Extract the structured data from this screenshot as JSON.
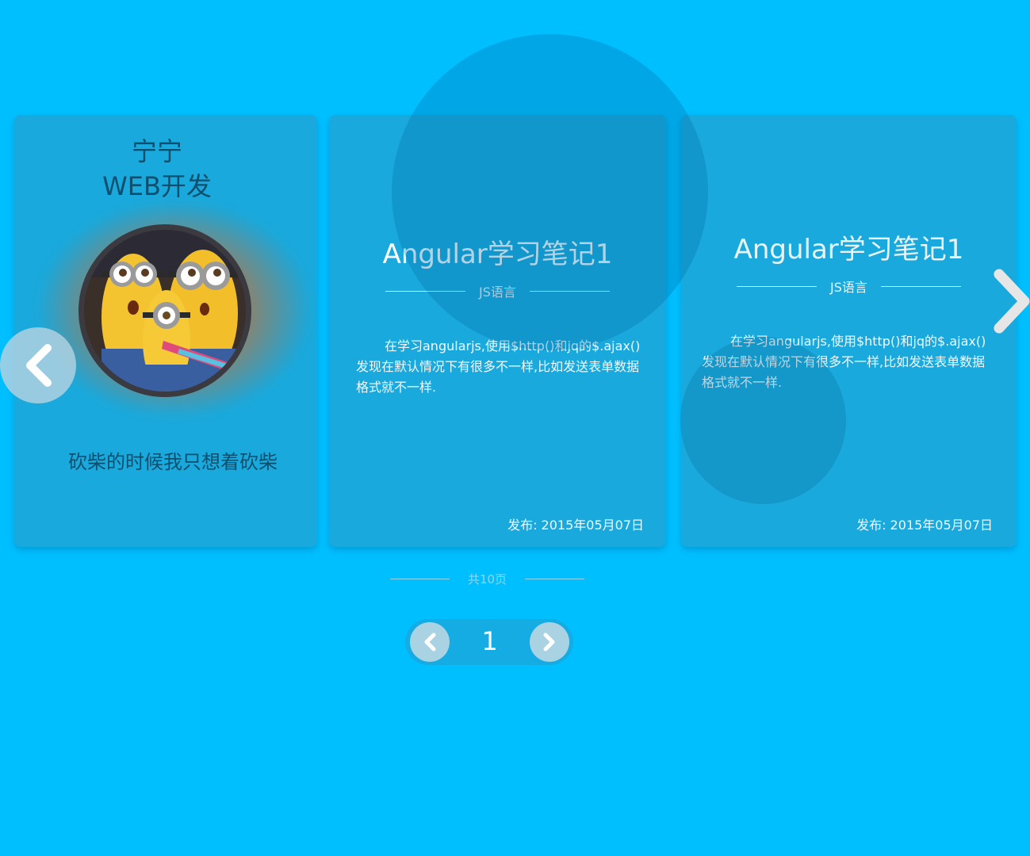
{
  "profile": {
    "name": "宁宁",
    "role": "WEB开发",
    "motto": "砍柴的时候我只想着砍柴",
    "avatar_icon": "minions-avatar"
  },
  "posts": [
    {
      "title": "Angular学习笔记1",
      "category": "JS语言",
      "excerpt": "在学习angularjs,使用$http()和jq的$.ajax()发现在默认情况下有很多不一样,比如发送表单数据格式就不一样.",
      "date": "发布: 2015年05月07日"
    },
    {
      "title": "Angular学习笔记1",
      "category": "JS语言",
      "excerpt": "在学习angularjs,使用$http()和jq的$.ajax()发现在默认情况下有很多不一样,比如发送表单数据格式就不一样.",
      "date": "发布: 2015年05月07日"
    }
  ],
  "carousel": {
    "prev_icon": "chevron-left-icon",
    "next_icon": "chevron-right-icon"
  },
  "pagination": {
    "total_label": "共10页",
    "current_page": "1",
    "prev_icon": "chevron-left-icon",
    "next_icon": "chevron-right-icon"
  },
  "colors": {
    "background": "#00bfff",
    "card": "#1aa9dc",
    "profile_text": "#0d4f6e",
    "pager_button": "#a9d3e3"
  }
}
